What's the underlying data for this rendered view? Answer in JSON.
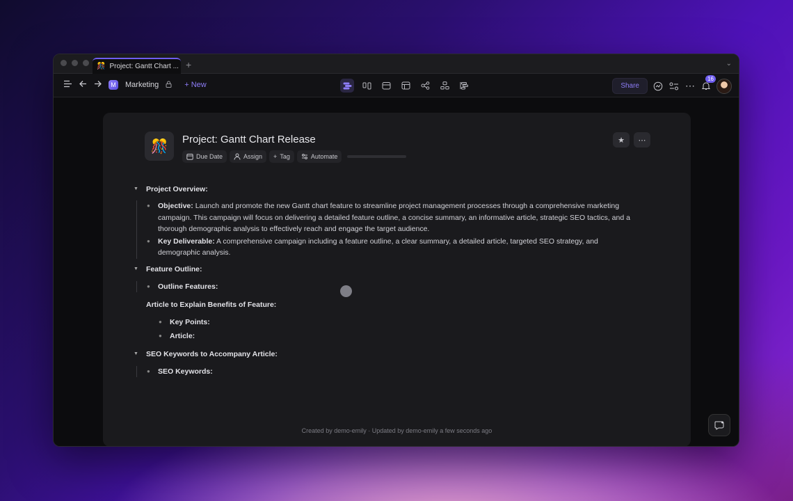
{
  "tab": {
    "title": "Project: Gantt Chart ...",
    "emoji": "🎊"
  },
  "toolbar": {
    "workspace": "Marketing",
    "workspace_initial": "M",
    "new_label": "New",
    "share_label": "Share",
    "notif_count": "16"
  },
  "doc": {
    "emoji": "🎊",
    "title": "Project: Gantt Chart Release",
    "props": {
      "due": "Due Date",
      "assign": "Assign",
      "tag": "Tag",
      "automate": "Automate"
    },
    "sections": [
      {
        "heading": "Project Overview:",
        "items": [
          {
            "label": "Objective:",
            "text": " Launch and promote the new Gantt chart feature to streamline project management processes through a comprehensive marketing campaign. This campaign will focus on delivering a detailed feature outline, a concise summary, an informative article, strategic SEO tactics, and a thorough demographic analysis to effectively reach and engage the target audience."
          },
          {
            "label": "Key Deliverable:",
            "text": " A comprehensive campaign including a feature outline, a clear summary, a detailed article, targeted SEO strategy, and demographic analysis."
          }
        ]
      },
      {
        "heading": "Feature Outline:",
        "items": [
          {
            "label": "Outline Features:",
            "text": ""
          }
        ]
      },
      {
        "heading": "Article to Explain Benefits of Feature:",
        "items": [
          {
            "label": "Key Points:",
            "text": ""
          },
          {
            "label": "Article:",
            "text": ""
          }
        ]
      },
      {
        "heading": "SEO Keywords to Accompany Article:",
        "items": [
          {
            "label": "SEO Keywords:",
            "text": ""
          }
        ]
      }
    ],
    "footer": "Created by demo-emily · Updated by demo-emily a few seconds ago"
  }
}
